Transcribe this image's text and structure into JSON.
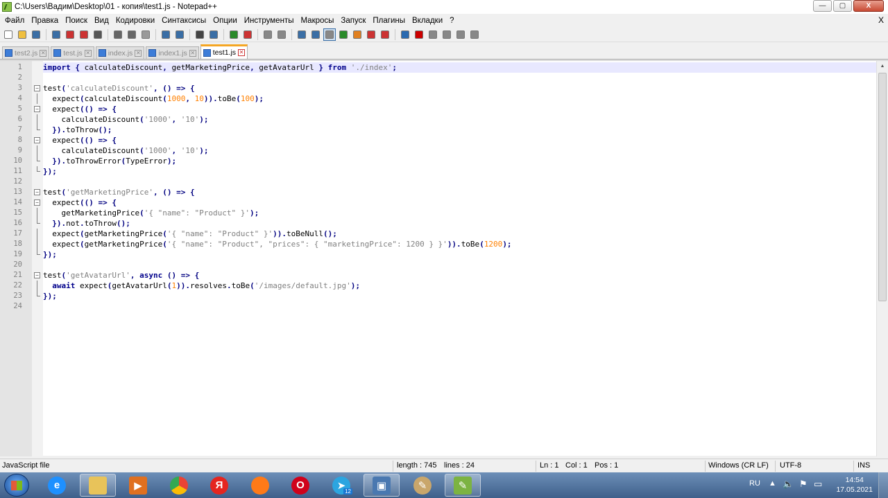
{
  "window": {
    "title": "C:\\Users\\Вадим\\Desktop\\01 - копия\\test1.js - Notepad++",
    "min_label": "—",
    "max_label": "▢",
    "close_label": "X"
  },
  "menu": {
    "items": [
      "Файл",
      "Правка",
      "Поиск",
      "Вид",
      "Кодировки",
      "Синтаксисы",
      "Опции",
      "Инструменты",
      "Макросы",
      "Запуск",
      "Плагины",
      "Вкладки",
      "?"
    ],
    "close_doc": "X"
  },
  "toolbar": {
    "buttons": [
      "new-file",
      "open-file",
      "save",
      "save-all",
      "close",
      "close-all",
      "print",
      "cut",
      "copy",
      "paste",
      "undo",
      "redo",
      "find",
      "replace",
      "zoom-in",
      "zoom-out",
      "sync-vertical",
      "sync-horizontal",
      "word-wrap",
      "show-all-chars",
      "indent-guide",
      "user-defined-lang",
      "doc-map",
      "function-list",
      "folder-workspace",
      "monitor",
      "record-macro",
      "stop-record",
      "play-macro",
      "run-macro-multiple",
      "save-macro"
    ]
  },
  "tabs": [
    {
      "label": "test2.js",
      "active": false
    },
    {
      "label": "test.js",
      "active": false
    },
    {
      "label": "index.js",
      "active": false
    },
    {
      "label": "index1.js",
      "active": false
    },
    {
      "label": "test1.js",
      "active": true
    }
  ],
  "editor": {
    "current_line": 1,
    "lines": [
      {
        "n": "1",
        "fold": "",
        "tokens": [
          [
            "kw",
            "import"
          ],
          [
            "id",
            " "
          ],
          [
            "op",
            "{"
          ],
          [
            "id",
            " calculateDiscount"
          ],
          [
            "op",
            ","
          ],
          [
            "id",
            " getMarketingPrice"
          ],
          [
            "op",
            ","
          ],
          [
            "id",
            " getAvatarUrl "
          ],
          [
            "op",
            "}"
          ],
          [
            "id",
            " "
          ],
          [
            "kw",
            "from"
          ],
          [
            "id",
            " "
          ],
          [
            "str",
            "'./index'"
          ],
          [
            "op",
            ";"
          ]
        ]
      },
      {
        "n": "2",
        "fold": "",
        "tokens": []
      },
      {
        "n": "3",
        "fold": "open",
        "tokens": [
          [
            "id",
            "test"
          ],
          [
            "op",
            "("
          ],
          [
            "str",
            "'calculateDiscount'"
          ],
          [
            "op",
            ","
          ],
          [
            "id",
            " "
          ],
          [
            "op",
            "()"
          ],
          [
            "id",
            " "
          ],
          [
            "op",
            "=>"
          ],
          [
            "id",
            " "
          ],
          [
            "op",
            "{"
          ]
        ]
      },
      {
        "n": "4",
        "fold": "line",
        "tokens": [
          [
            "id",
            "  expect"
          ],
          [
            "op",
            "("
          ],
          [
            "id",
            "calculateDiscount"
          ],
          [
            "op",
            "("
          ],
          [
            "num",
            "1000"
          ],
          [
            "op",
            ","
          ],
          [
            "id",
            " "
          ],
          [
            "num",
            "10"
          ],
          [
            "op",
            "))."
          ],
          [
            "id",
            "toBe"
          ],
          [
            "op",
            "("
          ],
          [
            "num",
            "100"
          ],
          [
            "op",
            ");"
          ]
        ]
      },
      {
        "n": "5",
        "fold": "open",
        "tokens": [
          [
            "id",
            "  expect"
          ],
          [
            "op",
            "(()"
          ],
          [
            "id",
            " "
          ],
          [
            "op",
            "=>"
          ],
          [
            "id",
            " "
          ],
          [
            "op",
            "{"
          ]
        ]
      },
      {
        "n": "6",
        "fold": "line",
        "tokens": [
          [
            "id",
            "    calculateDiscount"
          ],
          [
            "op",
            "("
          ],
          [
            "str",
            "'1000'"
          ],
          [
            "op",
            ","
          ],
          [
            "id",
            " "
          ],
          [
            "str",
            "'10'"
          ],
          [
            "op",
            ");"
          ]
        ]
      },
      {
        "n": "7",
        "fold": "end",
        "tokens": [
          [
            "id",
            "  "
          ],
          [
            "op",
            "})."
          ],
          [
            "id",
            "toThrow"
          ],
          [
            "op",
            "();"
          ]
        ]
      },
      {
        "n": "8",
        "fold": "open",
        "tokens": [
          [
            "id",
            "  expect"
          ],
          [
            "op",
            "(()"
          ],
          [
            "id",
            " "
          ],
          [
            "op",
            "=>"
          ],
          [
            "id",
            " "
          ],
          [
            "op",
            "{"
          ]
        ]
      },
      {
        "n": "9",
        "fold": "line",
        "tokens": [
          [
            "id",
            "    calculateDiscount"
          ],
          [
            "op",
            "("
          ],
          [
            "str",
            "'1000'"
          ],
          [
            "op",
            ","
          ],
          [
            "id",
            " "
          ],
          [
            "str",
            "'10'"
          ],
          [
            "op",
            ");"
          ]
        ]
      },
      {
        "n": "10",
        "fold": "end",
        "tokens": [
          [
            "id",
            "  "
          ],
          [
            "op",
            "})."
          ],
          [
            "id",
            "toThrowError"
          ],
          [
            "op",
            "("
          ],
          [
            "id",
            "TypeError"
          ],
          [
            "op",
            ");"
          ]
        ]
      },
      {
        "n": "11",
        "fold": "end",
        "tokens": [
          [
            "op",
            "});"
          ]
        ]
      },
      {
        "n": "12",
        "fold": "",
        "tokens": []
      },
      {
        "n": "13",
        "fold": "open",
        "tokens": [
          [
            "id",
            "test"
          ],
          [
            "op",
            "("
          ],
          [
            "str",
            "'getMarketingPrice'"
          ],
          [
            "op",
            ","
          ],
          [
            "id",
            " "
          ],
          [
            "op",
            "()"
          ],
          [
            "id",
            " "
          ],
          [
            "op",
            "=>"
          ],
          [
            "id",
            " "
          ],
          [
            "op",
            "{"
          ]
        ]
      },
      {
        "n": "14",
        "fold": "open",
        "tokens": [
          [
            "id",
            "  expect"
          ],
          [
            "op",
            "(()"
          ],
          [
            "id",
            " "
          ],
          [
            "op",
            "=>"
          ],
          [
            "id",
            " "
          ],
          [
            "op",
            "{"
          ]
        ]
      },
      {
        "n": "15",
        "fold": "line",
        "tokens": [
          [
            "id",
            "    getMarketingPrice"
          ],
          [
            "op",
            "("
          ],
          [
            "str",
            "'{ \"name\": \"Product\" }'"
          ],
          [
            "op",
            ");"
          ]
        ]
      },
      {
        "n": "16",
        "fold": "end",
        "tokens": [
          [
            "id",
            "  "
          ],
          [
            "op",
            "})."
          ],
          [
            "id",
            "not"
          ],
          [
            "op",
            "."
          ],
          [
            "id",
            "toThrow"
          ],
          [
            "op",
            "();"
          ]
        ]
      },
      {
        "n": "17",
        "fold": "line",
        "tokens": [
          [
            "id",
            "  expect"
          ],
          [
            "op",
            "("
          ],
          [
            "id",
            "getMarketingPrice"
          ],
          [
            "op",
            "("
          ],
          [
            "str",
            "'{ \"name\": \"Product\" }'"
          ],
          [
            "op",
            "))."
          ],
          [
            "id",
            "toBeNull"
          ],
          [
            "op",
            "();"
          ]
        ]
      },
      {
        "n": "18",
        "fold": "line",
        "tokens": [
          [
            "id",
            "  expect"
          ],
          [
            "op",
            "("
          ],
          [
            "id",
            "getMarketingPrice"
          ],
          [
            "op",
            "("
          ],
          [
            "str",
            "'{ \"name\": \"Product\", \"prices\": { \"marketingPrice\": 1200 } }'"
          ],
          [
            "op",
            "))."
          ],
          [
            "id",
            "toBe"
          ],
          [
            "op",
            "("
          ],
          [
            "num",
            "1200"
          ],
          [
            "op",
            ");"
          ]
        ]
      },
      {
        "n": "19",
        "fold": "end",
        "tokens": [
          [
            "op",
            "});"
          ]
        ]
      },
      {
        "n": "20",
        "fold": "",
        "tokens": []
      },
      {
        "n": "21",
        "fold": "open",
        "tokens": [
          [
            "id",
            "test"
          ],
          [
            "op",
            "("
          ],
          [
            "str",
            "'getAvatarUrl'"
          ],
          [
            "op",
            ","
          ],
          [
            "id",
            " "
          ],
          [
            "kw",
            "async"
          ],
          [
            "id",
            " "
          ],
          [
            "op",
            "()"
          ],
          [
            "id",
            " "
          ],
          [
            "op",
            "=>"
          ],
          [
            "id",
            " "
          ],
          [
            "op",
            "{"
          ]
        ]
      },
      {
        "n": "22",
        "fold": "line",
        "tokens": [
          [
            "id",
            "  "
          ],
          [
            "kw",
            "await"
          ],
          [
            "id",
            " expect"
          ],
          [
            "op",
            "("
          ],
          [
            "id",
            "getAvatarUrl"
          ],
          [
            "op",
            "("
          ],
          [
            "num",
            "1"
          ],
          [
            "op",
            "))."
          ],
          [
            "id",
            "resolves"
          ],
          [
            "op",
            "."
          ],
          [
            "id",
            "toBe"
          ],
          [
            "op",
            "("
          ],
          [
            "str",
            "'/images/default.jpg'"
          ],
          [
            "op",
            ");"
          ]
        ]
      },
      {
        "n": "23",
        "fold": "end",
        "tokens": [
          [
            "op",
            "});"
          ]
        ]
      },
      {
        "n": "24",
        "fold": "",
        "tokens": []
      }
    ]
  },
  "status": {
    "file_type": "JavaScript file",
    "length": "length : 745",
    "lines": "lines : 24",
    "ln": "Ln : 1",
    "col": "Col : 1",
    "pos": "Pos : 1",
    "eol": "Windows (CR LF)",
    "encoding": "UTF-8",
    "mode": "INS"
  },
  "taskbar": {
    "apps": [
      {
        "name": "internet-explorer",
        "glyph": "e",
        "color": "#1e90ff",
        "open": false
      },
      {
        "name": "file-explorer",
        "glyph": "",
        "color": "#e8c35a",
        "open": true
      },
      {
        "name": "media-player",
        "glyph": "▶",
        "color": "#e07020",
        "open": false
      },
      {
        "name": "chrome",
        "glyph": "",
        "color": "#34a853",
        "open": false
      },
      {
        "name": "yandex-browser",
        "glyph": "Я",
        "color": "#e52620",
        "open": false
      },
      {
        "name": "firefox",
        "glyph": "",
        "color": "#ff7a18",
        "open": false
      },
      {
        "name": "opera",
        "glyph": "O",
        "color": "#d0021b",
        "open": false
      },
      {
        "name": "telegram",
        "glyph": "➤",
        "color": "#2ca5e0",
        "open": false
      },
      {
        "name": "screenshot-app",
        "glyph": "▣",
        "color": "#4a78b0",
        "open": true
      },
      {
        "name": "paint",
        "glyph": "✎",
        "color": "#c9a66b",
        "open": false
      },
      {
        "name": "notepad-plus-plus",
        "glyph": "✎",
        "color": "#7cb342",
        "open": true
      }
    ],
    "telegram_badge": "12",
    "language": "RU",
    "time": "14:54",
    "date": "17.05.2021"
  }
}
